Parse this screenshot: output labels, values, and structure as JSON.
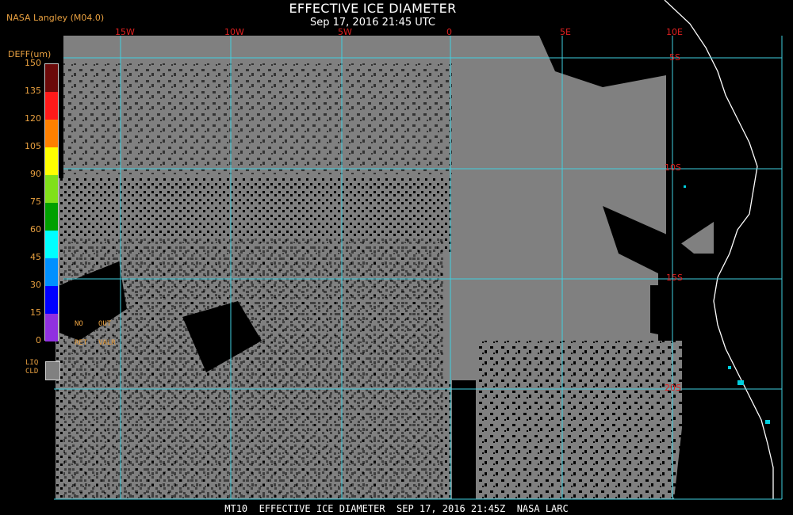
{
  "header": {
    "credit": "NASA Langley (M04.0)",
    "title": "EFFECTIVE ICE DIAMETER",
    "subtitle": "Sep 17, 2016 21:45 UTC"
  },
  "legend": {
    "title": "DEFF(um)",
    "ticks": [
      "150",
      "135",
      "120",
      "105",
      "90",
      "75",
      "60",
      "45",
      "30",
      "15",
      "0"
    ],
    "colors": [
      "#6b0a0a",
      "#a00a0a",
      "#ff1a1a",
      "#ff8000",
      "#ffff00",
      "#80e01a",
      "#00a000",
      "#00ffff",
      "#0090ff",
      "#0000ff",
      "#9030e0"
    ],
    "no_label": "NO",
    "out_label": "OUT",
    "ret_label": "RET",
    "valr_label": "VALR",
    "liq_label": "LIQ",
    "cld_label": "CLD"
  },
  "grid": {
    "lon_labels": [
      "15W",
      "10W",
      "5W",
      "0",
      "5E",
      "10E"
    ],
    "lat_labels": [
      "5S",
      "10S",
      "15S",
      "20S"
    ],
    "grid_color": "#40d0e0",
    "cloud_color": "#808080"
  },
  "footer": {
    "text": "MT10  EFFECTIVE ICE DIAMETER  SEP 17, 2016 21:45Z  NASA LARC"
  }
}
